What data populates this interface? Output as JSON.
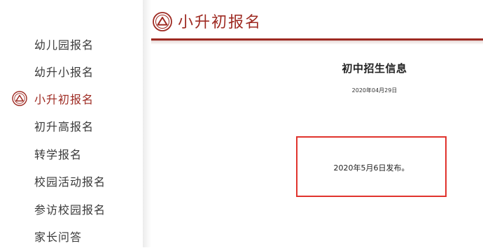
{
  "sidebar": {
    "items": [
      {
        "label": "幼儿园报名",
        "active": false
      },
      {
        "label": "幼升小报名",
        "active": false
      },
      {
        "label": "小升初报名",
        "active": true
      },
      {
        "label": "初升高报名",
        "active": false
      },
      {
        "label": "转学报名",
        "active": false
      },
      {
        "label": "校园活动报名",
        "active": false
      },
      {
        "label": "参访校园报名",
        "active": false
      },
      {
        "label": "家长问答",
        "active": false
      }
    ],
    "active_icon": "school-emblem-icon"
  },
  "header": {
    "title": "小升初报名",
    "logo_icon": "school-emblem-icon"
  },
  "article": {
    "title": "初中招生信息",
    "date": "2020年04月29日",
    "body": "2020年5月6日发布。"
  },
  "colors": {
    "accent": "#9e2a22",
    "highlight_border": "#e0332d"
  }
}
